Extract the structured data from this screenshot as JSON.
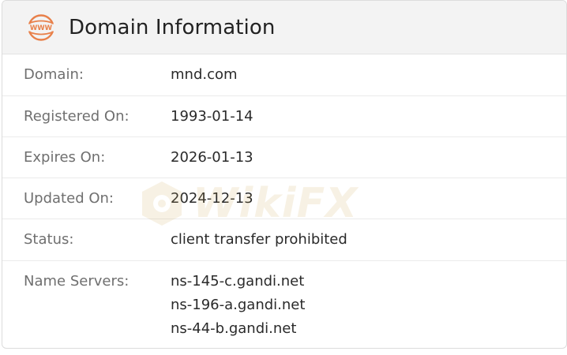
{
  "header": {
    "icon": "www-globe-icon",
    "icon_text": "WWW",
    "title": "Domain Information",
    "accent_color": "#e8804a"
  },
  "rows": [
    {
      "label": "Domain:",
      "value": "mnd.com"
    },
    {
      "label": "Registered On:",
      "value": "1993-01-14"
    },
    {
      "label": "Expires On:",
      "value": "2026-01-13"
    },
    {
      "label": "Updated On:",
      "value": "2024-12-13"
    },
    {
      "label": "Status:",
      "value": "client transfer prohibited"
    }
  ],
  "name_servers": {
    "label": "Name Servers:",
    "values": [
      "ns-145-c.gandi.net",
      "ns-196-a.gandi.net",
      "ns-44-b.gandi.net"
    ]
  },
  "watermark": {
    "text": "WikiFX",
    "color": "#c9a24a"
  }
}
